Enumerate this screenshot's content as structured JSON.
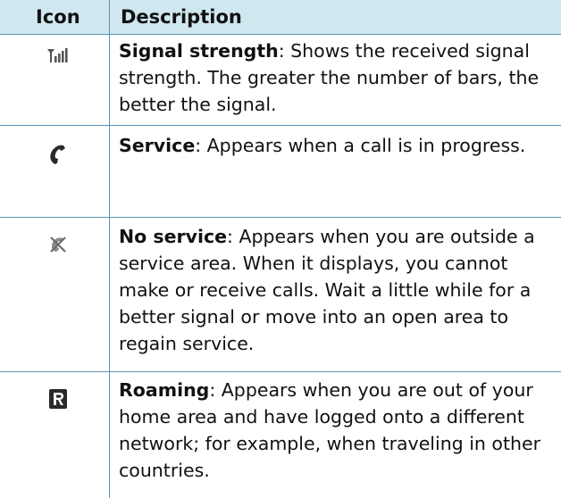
{
  "table": {
    "header": {
      "icon_col": "Icon",
      "desc_col": "Description"
    },
    "rows": [
      {
        "icon": "signal-strength-icon",
        "title": "Signal strength",
        "text": ": Shows the received signal strength. The greater the number of bars, the better the signal."
      },
      {
        "icon": "service-handset-icon",
        "title": "Service",
        "text": ": Appears when a call is in progress."
      },
      {
        "icon": "no-service-icon",
        "title": "No service",
        "text": ": Appears when you are outside a service area. When it displays, you cannot make or receive calls. Wait a little while for a better signal or move into an open area to regain service."
      },
      {
        "icon": "roaming-icon",
        "title": "Roaming",
        "text": ": Appears when you are out of your home area and have logged onto a different network; for example, when traveling in other countries."
      }
    ]
  },
  "colors": {
    "header_bg": "#cfe7ef",
    "rule": "#5b93b0"
  }
}
